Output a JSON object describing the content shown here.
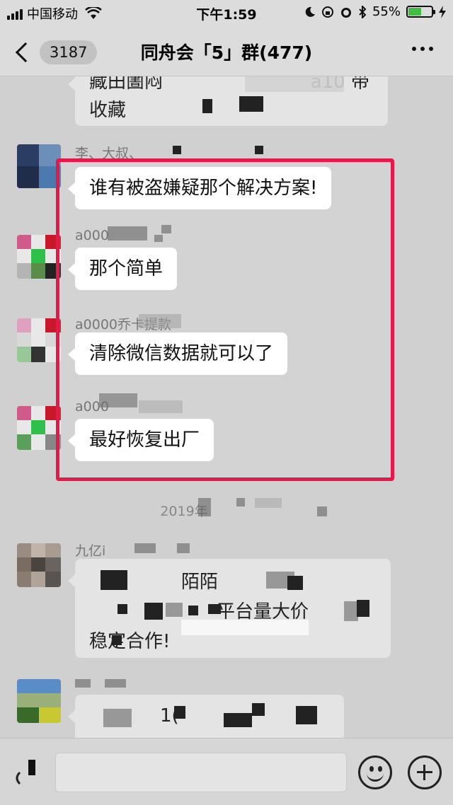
{
  "status_bar": {
    "carrier": "中国移动",
    "time": "下午1:59",
    "battery_text": "55%",
    "battery_level": 0.55,
    "icons": [
      "signal-icon",
      "wifi-icon",
      "moon-icon",
      "lock-rotation-icon",
      "alarm-icon",
      "bluetooth-icon",
      "battery-icon",
      "charging-icon"
    ]
  },
  "nav": {
    "back_count": "3187",
    "title": "同舟会「5」群(477)"
  },
  "messages": {
    "top_partial": {
      "line1": "藏田圕闷",
      "line2": "收藏",
      "tail": "a10 带"
    },
    "msg1": {
      "sender": "李、大叔、",
      "text": "谁有被盗嫌疑那个解决方案!"
    },
    "msg2": {
      "sender": "a000",
      "text": "那个简单"
    },
    "msg3": {
      "sender": "a0000乔卡提款",
      "text": "清除微信数据就可以了"
    },
    "msg4": {
      "sender": "a000",
      "text": "最好恢复出厂"
    },
    "date_divider": "2019年",
    "msg5": {
      "sender": "九亿i",
      "line1": "陌陌",
      "line2": "平台量大价",
      "line3": "稳定合作!"
    },
    "msg6": {
      "text": "1("
    }
  },
  "colors": {
    "highlight": "#e8174a",
    "bubble_white": "#ffffff",
    "background": "#d0d0d0"
  }
}
